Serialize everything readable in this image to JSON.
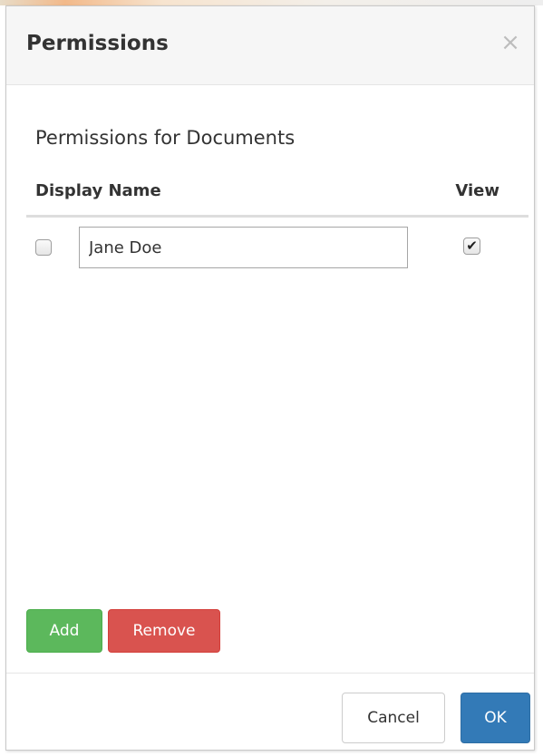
{
  "dialog": {
    "title": "Permissions",
    "close_glyph": "×",
    "section_title": "Permissions for Documents"
  },
  "table": {
    "columns": [
      "Display Name",
      "View"
    ],
    "rows": [
      {
        "selected": false,
        "display_name": "Jane Doe",
        "view": true,
        "view_glyph": "✔"
      }
    ]
  },
  "actions": {
    "add_label": "Add",
    "remove_label": "Remove"
  },
  "footer": {
    "cancel_label": "Cancel",
    "ok_label": "OK"
  },
  "colors": {
    "add": "#5cb85c",
    "remove": "#d9534f",
    "ok": "#337ab7"
  },
  "icons": {
    "close": "close-icon",
    "checkmark": "checkmark-icon"
  }
}
